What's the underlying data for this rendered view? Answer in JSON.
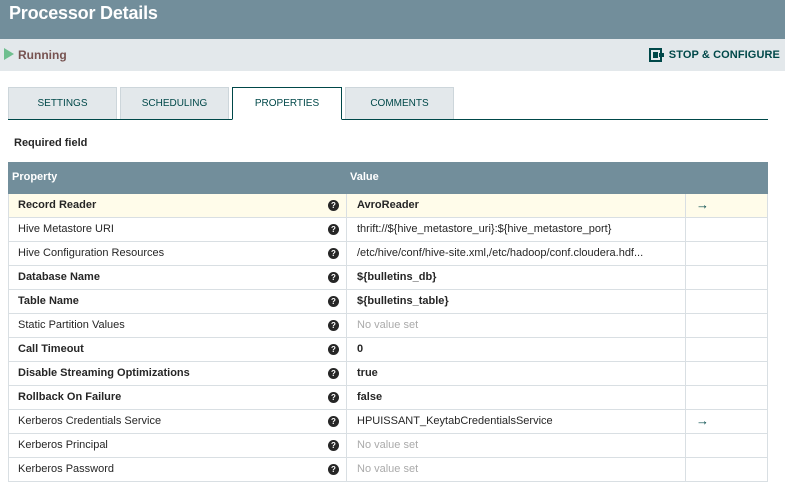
{
  "header": {
    "title": "Processor Details"
  },
  "status": {
    "state_label": "Running",
    "stop_configure_label": "STOP & CONFIGURE"
  },
  "tabs": [
    {
      "label": "SETTINGS",
      "active": false
    },
    {
      "label": "SCHEDULING",
      "active": false
    },
    {
      "label": "PROPERTIES",
      "active": true
    },
    {
      "label": "COMMENTS",
      "active": false
    }
  ],
  "required_field_label": "Required field",
  "table": {
    "headers": {
      "property": "Property",
      "value": "Value"
    },
    "rows": [
      {
        "property": "Record Reader",
        "value": "AvroReader",
        "required": true,
        "unset": false,
        "goto": true,
        "selected": true
      },
      {
        "property": "Hive Metastore URI",
        "value": "thrift://${hive_metastore_uri}:${hive_metastore_port}",
        "required": false,
        "unset": false,
        "goto": false,
        "selected": false
      },
      {
        "property": "Hive Configuration Resources",
        "value": "/etc/hive/conf/hive-site.xml,/etc/hadoop/conf.cloudera.hdf...",
        "required": false,
        "unset": false,
        "goto": false,
        "selected": false
      },
      {
        "property": "Database Name",
        "value": "${bulletins_db}",
        "required": true,
        "unset": false,
        "goto": false,
        "selected": false
      },
      {
        "property": "Table Name",
        "value": "${bulletins_table}",
        "required": true,
        "unset": false,
        "goto": false,
        "selected": false
      },
      {
        "property": "Static Partition Values",
        "value": "No value set",
        "required": false,
        "unset": true,
        "goto": false,
        "selected": false
      },
      {
        "property": "Call Timeout",
        "value": "0",
        "required": true,
        "unset": false,
        "goto": false,
        "selected": false
      },
      {
        "property": "Disable Streaming Optimizations",
        "value": "true",
        "required": true,
        "unset": false,
        "goto": false,
        "selected": false
      },
      {
        "property": "Rollback On Failure",
        "value": "false",
        "required": true,
        "unset": false,
        "goto": false,
        "selected": false
      },
      {
        "property": "Kerberos Credentials Service",
        "value": "HPUISSANT_KeytabCredentialsService",
        "required": false,
        "unset": false,
        "goto": true,
        "selected": false
      },
      {
        "property": "Kerberos Principal",
        "value": "No value set",
        "required": false,
        "unset": true,
        "goto": false,
        "selected": false
      },
      {
        "property": "Kerberos Password",
        "value": "No value set",
        "required": false,
        "unset": true,
        "goto": false,
        "selected": false
      }
    ]
  },
  "icons": {
    "help": "help-icon",
    "goto": "arrow-right-icon",
    "run": "play-icon",
    "stop": "stop-configure-icon"
  },
  "colors": {
    "header_bg": "#728e9b",
    "accent": "#004849",
    "running": "#6fbf8f",
    "selected_row": "#fffcea"
  }
}
